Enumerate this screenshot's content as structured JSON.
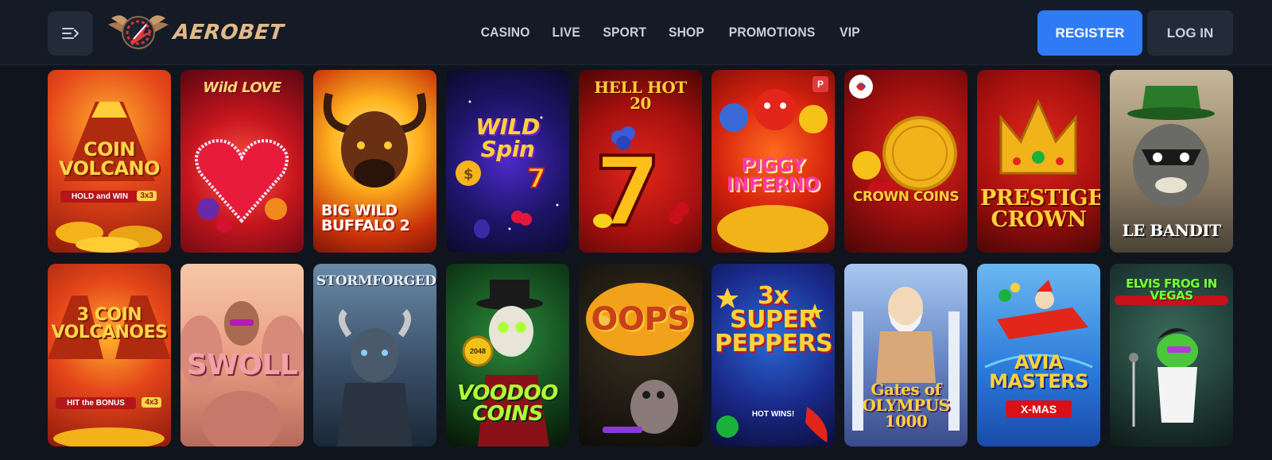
{
  "brand": {
    "name": "AEROBET"
  },
  "nav": [
    "CASINO",
    "LIVE",
    "SPORT",
    "SHOP",
    "PROMOTIONS",
    "VIP"
  ],
  "actions": {
    "register": "REGISTER",
    "login": "LOG IN"
  },
  "colors": {
    "background": "#10151d",
    "header": "#141b26",
    "accent": "#2f7bf5",
    "button_dark": "#222b38"
  },
  "games": [
    {
      "title": "COIN VOLCANO",
      "subtitle": "HOLD and WIN",
      "badge": "3x3"
    },
    {
      "title": "Wild LOVE"
    },
    {
      "title": "BIG WILD BUFFALO 2"
    },
    {
      "title": "WILD Spin"
    },
    {
      "title": "HELL HOT 20"
    },
    {
      "title": "PIGGY INFERNO",
      "badge": "P"
    },
    {
      "title": "CROWN COINS"
    },
    {
      "title": "PRESTIGE CROWN"
    },
    {
      "title": "LE BANDIT"
    },
    {
      "title": "3 COIN VOLCANOES",
      "subtitle": "HIT the BONUS",
      "badge": "4x3"
    },
    {
      "title": "SWOLL"
    },
    {
      "title": "STORMFORGED"
    },
    {
      "title": "VOODOO COINS",
      "badge": "2048"
    },
    {
      "title": "OOPS"
    },
    {
      "title": "3x SUPER PEPPERS",
      "subtitle": "HOT WINS!"
    },
    {
      "title": "Gates of OLYMPUS 1000"
    },
    {
      "title": "AVIA MASTERS",
      "subtitle": "X-MAS"
    },
    {
      "title": "ELVIS FROG IN VEGAS"
    }
  ]
}
